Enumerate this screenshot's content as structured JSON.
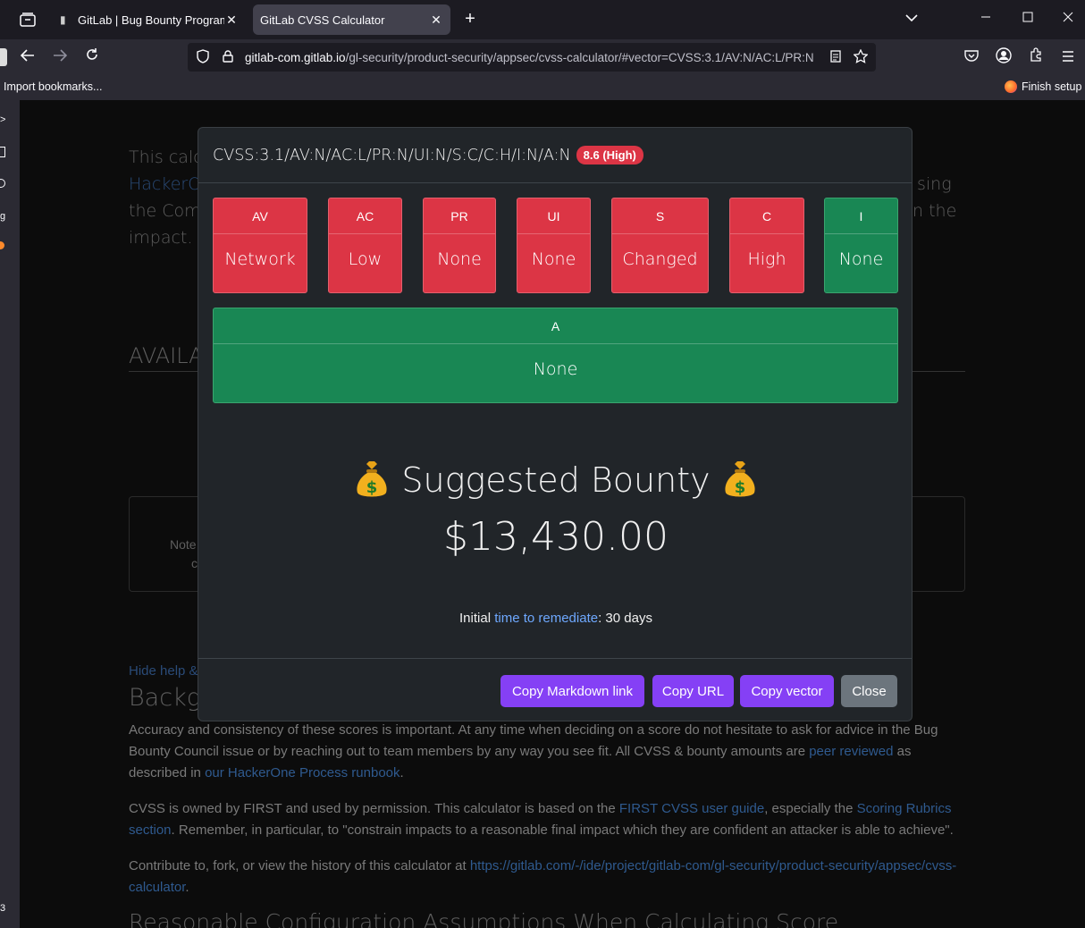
{
  "browser": {
    "tabs": [
      {
        "title": "GitLab | Bug Bounty Program Po",
        "active": false
      },
      {
        "title": "GitLab CVSS Calculator",
        "active": true
      }
    ],
    "url_host": "gitlab-com.gitlab.io",
    "url_path": "/gl-security/product-security/appsec/cvss-calculator/#vector=CVSS:3.1/AV:N/AC:L/PR:N",
    "bookmarks": {
      "import_label": "Import bookmarks...",
      "finish_setup": "Finish setup"
    }
  },
  "background_page": {
    "intro_line1": "This calcu",
    "intro_line1_right": "sing",
    "intro_link": "HackerOr",
    "intro_line3": "the Comm",
    "intro_line3_right": "n the",
    "intro_line4": "impact.",
    "available_heading": "AVAILA",
    "note_text": "Note",
    "note_text2": "c",
    "hide_help": "Hide help &",
    "background_heading": "Backgr",
    "para1": {
      "text1": "Accuracy and consistency of these scores is important. At any time when deciding on a score do not hesitate to ask for advice in the Bug Bounty Council issue or by reaching out to team members by any way you see fit. All CVSS & bounty amounts are ",
      "link1": "peer reviewed",
      "text2": " as described in ",
      "link2": "our HackerOne Process runbook",
      "text3": "."
    },
    "para2": {
      "text1": "CVSS is owned by FIRST and used by permission. This calculator is based on the ",
      "link1": "FIRST CVSS user guide",
      "text2": ", especially the ",
      "link2": "Scoring Rubrics section",
      "text3": ". Remember, in particular, to \"constrain impacts to a reasonable final impact which they are confident an attacker is able to achieve\"."
    },
    "para3": {
      "text1": "Contribute to, fork, or view the history of this calculator at ",
      "link1": "https://gitlab.com/-/ide/project/gitlab-com/gl-security/product-security/appsec/cvss-calculator",
      "text2": "."
    },
    "bottom_heading": "Reasonable Configuration Assumptions When Calculating Score"
  },
  "modal": {
    "vector": "CVSS:3.1/AV:N/AC:L/PR:N/UI:N/S:C/C:H/I:N/A:N",
    "score_badge": "8.6 (High)",
    "metrics": [
      {
        "label": "AV",
        "value": "Network",
        "color": "#dc3545"
      },
      {
        "label": "AC",
        "value": "Low",
        "color": "#dc3545"
      },
      {
        "label": "PR",
        "value": "None",
        "color": "#dc3545"
      },
      {
        "label": "UI",
        "value": "None",
        "color": "#dc3545"
      },
      {
        "label": "S",
        "value": "Changed",
        "color": "#dc3545"
      },
      {
        "label": "C",
        "value": "High",
        "color": "#dc3545"
      },
      {
        "label": "I",
        "value": "None",
        "color": "#198754"
      },
      {
        "label": "A",
        "value": "None",
        "color": "#198754"
      }
    ],
    "bounty_title": "Suggested Bounty",
    "bounty_amount": "$13,430.00",
    "remediate_prefix": "Initial ",
    "remediate_link": "time to remediate",
    "remediate_suffix": ": 30 days",
    "buttons": {
      "copy_markdown": "Copy Markdown link",
      "copy_url": "Copy URL",
      "copy_vector": "Copy vector",
      "close": "Close"
    }
  }
}
